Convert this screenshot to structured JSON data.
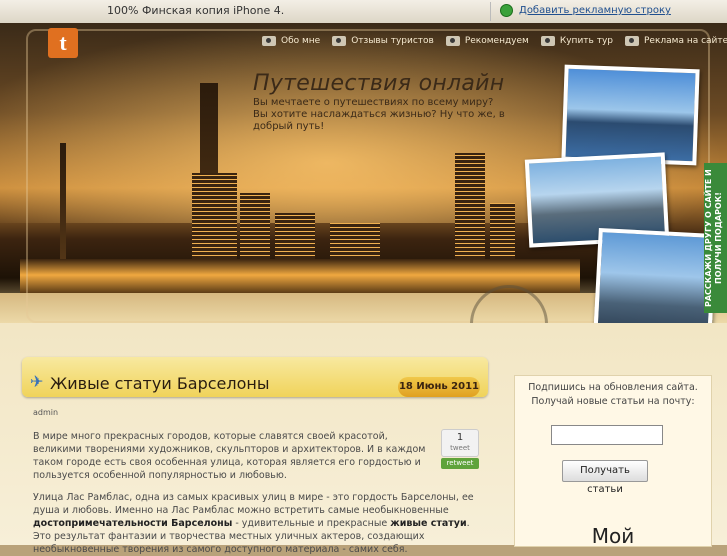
{
  "topbar": {
    "promo": "100% Финская копия iPhone 4.",
    "add_ad": "Добавить рекламную строку"
  },
  "header": {
    "logo_letter": "t",
    "nav": [
      "Обо мне",
      "Отзывы туристов",
      "Рекомендуем",
      "Купить тур",
      "Реклама на сайте"
    ],
    "title": "Путешествия онлайн",
    "subtitle": "Вы мечтаете о путешествиях по всему миру? Вы хотите наслаждаться жизнью? Ну что же, в добрый путь!",
    "side_tab": "РАССКАЖИ ДРУГУ О САЙТЕ И ПОЛУЧИ ПОДАРОК!"
  },
  "post": {
    "title": "Живые статуи Барселоны",
    "date": "18 Июнь 2011",
    "author": "admin",
    "p1": "В мире много прекрасных городов, которые славятся своей красотой, великими творениями художников, скульпторов и архитекторов. И в каждом таком городе есть своя особенная улица, которая является его гордостью и пользуется особенной популярностью и любовью.",
    "p2a": "Улица Лас Рамблас, одна из самых красивых улиц в мире - это гордость Барселоны, ее душа и любовь. Именно на Лас Рамблас можно встретить самые необыкновенные",
    "p2b": "достопримечательности Барселоны",
    "p2c": "- удивительные и прекрасные",
    "p2d": "живые статуи",
    "p2e": ". Это результат фантазии и творчества местных уличных актеров, создающих необыкновенные творения из самого доступного материала - самих себя.",
    "tweet_count": "1",
    "tweet_label": "tweet",
    "retweet": "retweet"
  },
  "sidebar": {
    "line1": "Подпишись на обновления сайта.",
    "line2": "Получай новые статьи на почту:",
    "email_value": "",
    "submit": "Получать статьи",
    "heading": "Мой"
  },
  "colors": {
    "accent": "#f0c84a",
    "link": "#1f4f8f",
    "retweet": "#5fa33b"
  }
}
